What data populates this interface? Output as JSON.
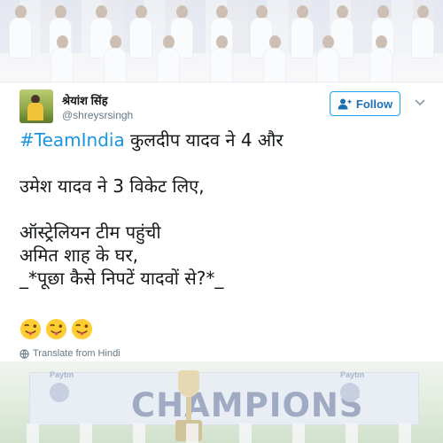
{
  "header_image": {
    "description_icon": "team-photo"
  },
  "tweet": {
    "display_name": "श्रेयांश सिंह",
    "username": "@shreysrsingh",
    "follow_label": "Follow",
    "hashtag": "#TeamIndia",
    "line1_rest": " कुलदीप यादव ने 4 और",
    "line2": "उमेश यादव ने 3 विकेट लिए,",
    "line3": "ऑस्ट्रेलियन टीम पहुंची",
    "line4": "अमित शाह के घर,",
    "line5": "_*पूछा कैसे निपटें यादवों से?*_",
    "emojis": [
      "tongue-wink-emoji",
      "tongue-wink-emoji",
      "tongue-wink-emoji"
    ],
    "translate_label": "Translate from Hindi"
  },
  "footer_image": {
    "banner_text": "CHAMPIONS",
    "sponsor_left": "Paytm",
    "sponsor_right": "Paytm"
  },
  "colors": {
    "hashtag": "#1b95e0",
    "follow_border": "#1da1f2",
    "text": "#14171a",
    "secondary": "#657786"
  }
}
